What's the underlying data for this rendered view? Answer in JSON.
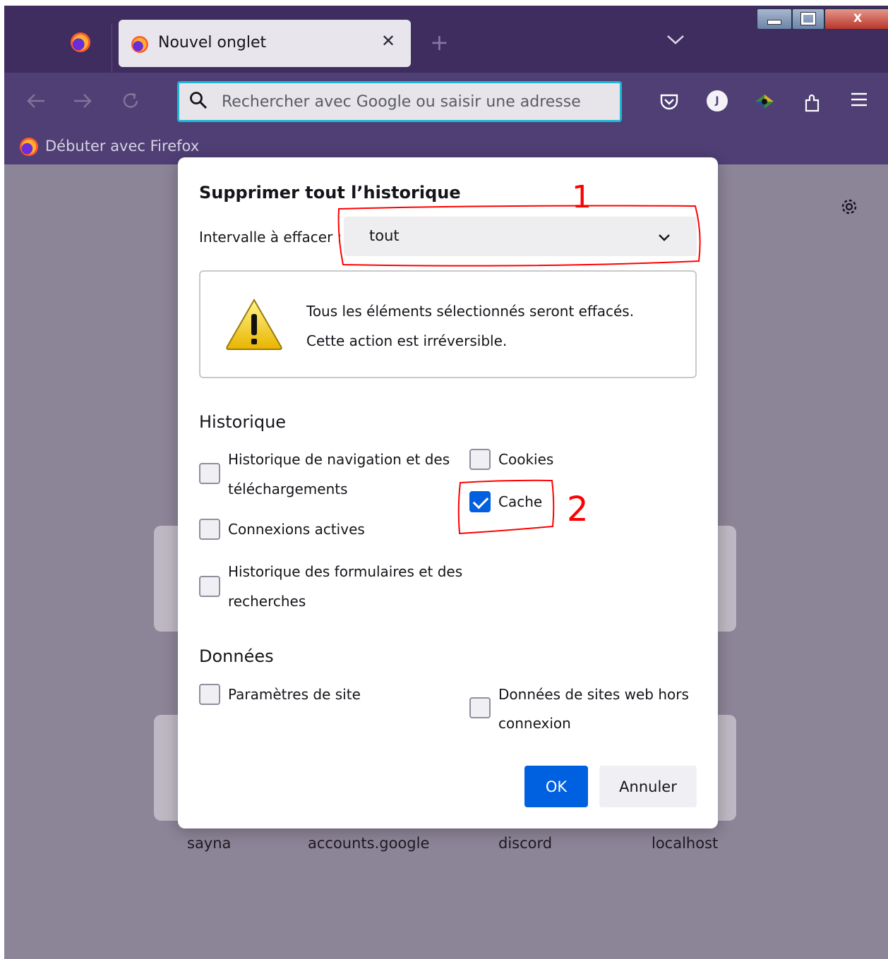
{
  "browser": {
    "tab_title": "Nouvel onglet",
    "tab_close": "✕",
    "new_tab": "+",
    "tab_list": "⌄",
    "url_placeholder": "Rechercher avec Google ou saisir une adresse",
    "account_initial": "J",
    "bookmark_label": "Débuter avec Firefox"
  },
  "content": {
    "tiles": [
      "sayna",
      "accounts.google",
      "discord",
      "localhost"
    ]
  },
  "dialog": {
    "title": "Supprimer tout l’historique",
    "range_label": "Intervalle à effacer :",
    "range_value": "tout",
    "warning_line1": "Tous les éléments sélectionnés seront effacés.",
    "warning_line2": "Cette action est irréversible.",
    "history_section": "Historique",
    "history_items": {
      "navigation_line1": "Historique de navigation et des",
      "navigation_line2": "téléchargements",
      "cookies": "Cookies",
      "cache": "Cache",
      "active_connections": "Connexions actives",
      "forms_line1": "Historique des formulaires et des",
      "forms_line2": "recherches"
    },
    "data_section": "Données",
    "data_items": {
      "site_settings": "Paramètres de site",
      "offline_line1": "Données de sites web hors",
      "offline_line2": "connexion"
    },
    "ok_label": "OK",
    "cancel_label": "Annuler"
  },
  "annotations": {
    "mark_1": "1",
    "mark_2": "2"
  },
  "colors": {
    "tabstrip": "#3f2d5f",
    "toolbar": "#4f3f75",
    "accent_blue": "#0061e0",
    "annotation_red": "#ff0000"
  }
}
